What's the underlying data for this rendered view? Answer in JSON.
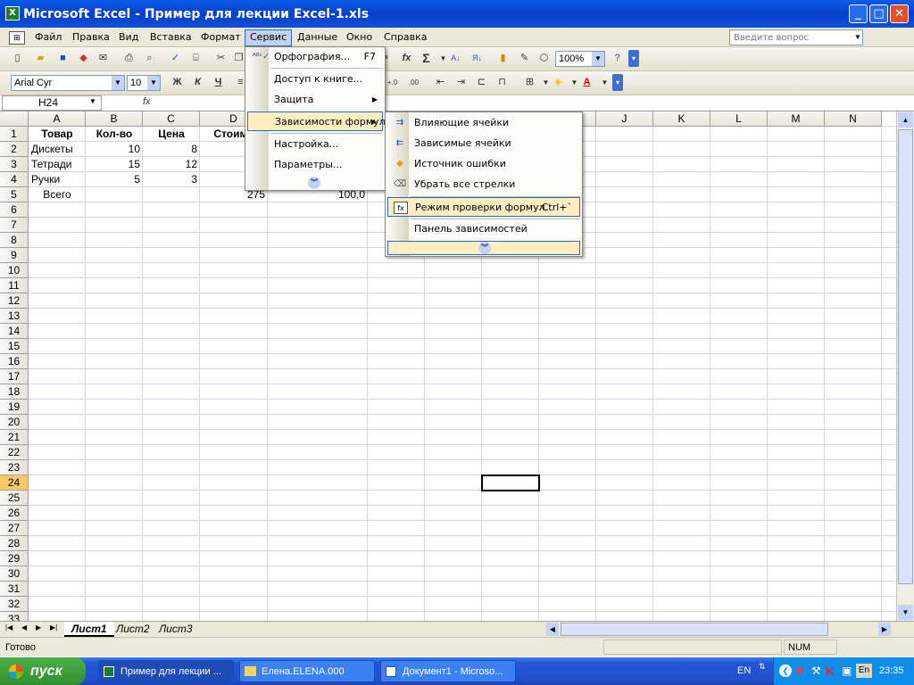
{
  "window": {
    "title": "Microsoft Excel - Пример для лекции Excel-1.xls",
    "app_icon": "X"
  },
  "menubar": {
    "items": [
      "Файл",
      "Правка",
      "Вид",
      "Вставка",
      "Формат",
      "Сервис",
      "Данные",
      "Окно",
      "Справка"
    ],
    "open_item": "Сервис",
    "question_placeholder": "Введите вопрос"
  },
  "toolbar": {
    "zoom": "100%",
    "font_name": "Arial Cyr",
    "font_size": "10",
    "bold": "Ж",
    "italic": "К",
    "underline": "Ч"
  },
  "formula_bar": {
    "name_box": "H24",
    "fx": "fx",
    "content": ""
  },
  "columns": [
    "A",
    "B",
    "C",
    "D",
    "E",
    "F",
    "G",
    "H",
    "I",
    "J",
    "K",
    "L",
    "M",
    "N"
  ],
  "active_cell": {
    "col": "H",
    "row": 24
  },
  "rows_visible": 33,
  "cells": {
    "A1": "Товар",
    "B1": "Кол-во",
    "C1": "Цена",
    "D1": "Стоимо",
    "A2": "Дискеты",
    "B2": "10",
    "C2": "8",
    "A3": "Тетради",
    "B3": "15",
    "C3": "12",
    "A4": "Ручки",
    "B4": "5",
    "C4": "3",
    "A5": "Всего",
    "D5": "275",
    "E5": "100,0"
  },
  "service_menu": {
    "items": [
      {
        "label": "Орфография...",
        "shortcut": "F7",
        "icon": "spell-check-icon"
      },
      {
        "label": "Доступ к книге...",
        "shortcut": ""
      },
      {
        "label": "Защита",
        "submenu": true
      },
      {
        "label": "Зависимости формул",
        "submenu": true,
        "highlighted": true
      },
      {
        "label": "Настройка...",
        "shortcut": ""
      },
      {
        "label": "Параметры...",
        "shortcut": ""
      }
    ]
  },
  "formula_submenu": {
    "items": [
      {
        "label": "Влияющие ячейки",
        "icon": "trace-precedents-icon"
      },
      {
        "label": "Зависимые ячейки",
        "icon": "trace-dependents-icon"
      },
      {
        "label": "Источник ошибки",
        "icon": "trace-error-icon"
      },
      {
        "label": "Убрать все стрелки",
        "icon": "remove-arrows-icon"
      },
      {
        "label": "Режим проверки формул",
        "shortcut": "Ctrl+`",
        "icon": "formula-audit-icon",
        "highlighted": true
      },
      {
        "label": "Панель зависимостей",
        "icon": ""
      }
    ]
  },
  "sheet_tabs": [
    "Лист1",
    "Лист2",
    "Лист3"
  ],
  "active_sheet": "Лист1",
  "status": {
    "left": "Готово",
    "num": "NUM"
  },
  "taskbar": {
    "start": "пуск",
    "tasks": [
      "Пример для лекции ...",
      "Елена.ELENA.000",
      "Документ1 - Microso..."
    ],
    "lang": "EN",
    "lang2": "En",
    "clock": "23:35"
  },
  "colors": {
    "title_blue": "#0a5ce8",
    "menu_highlight": "#ffeec2",
    "selection_border": "#316ac5",
    "taskbar_blue": "#2458d8",
    "start_green": "#3c9b3a"
  }
}
